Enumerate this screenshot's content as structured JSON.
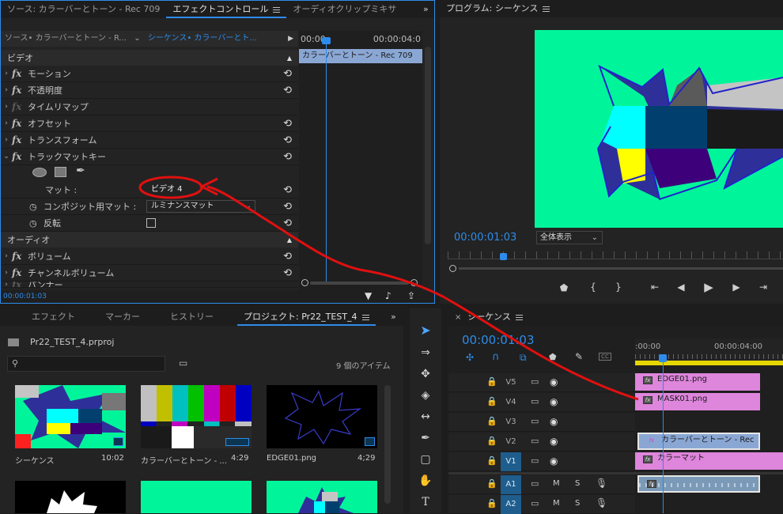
{
  "effect_panel": {
    "tabs": [
      "ソース: カラーバーとトーン - Rec 709",
      "エフェクトコントロール",
      "オーディオクリップミキサ"
    ],
    "source_label": "ソース• カラーバーとトーン - R...",
    "sequence_label": "シーケンス• カラーバーとト...",
    "time_start": "00:00",
    "time_end": "00:00:04:0",
    "clip_name": "カラーバーとトーン - Rec 709",
    "video_section": "ビデオ",
    "audio_section": "オーディオ",
    "effects": [
      "モーション",
      "不透明度",
      "タイムリマップ",
      "オフセット",
      "トランスフォーム",
      "トラックマットキー"
    ],
    "matte_label": "マット :",
    "matte_value": "ビデオ 4",
    "composite_label": "コンポジット用マット :",
    "composite_value": "ルミナンスマット",
    "reverse_label": "反転",
    "audio_effects": [
      "ボリューム",
      "チャンネルボリューム",
      "パンナー"
    ],
    "timecode": "00:00:01:03"
  },
  "program": {
    "title": "プログラム: シーケンス",
    "timecode": "00:00:01:03",
    "fit_label": "全体表示"
  },
  "project_panel": {
    "tabs": [
      "エフェクト",
      "マーカー",
      "ヒストリー",
      "プロジェクト: Pr22_TEST_4"
    ],
    "file_name": "Pr22_TEST_4.prproj",
    "item_count": "9 個のアイテム",
    "items": [
      {
        "name": "シーケンス",
        "duration": "10:02"
      },
      {
        "name": "カラーバーとトーン - ...",
        "duration": "4:29"
      },
      {
        "name": "EDGE01.png",
        "duration": "4;29"
      }
    ]
  },
  "timeline": {
    "tab": "シーケンス",
    "timecode": "00:00:01:03",
    "ruler_start": ":00:00",
    "ruler_end": "00:00:04:00",
    "tracks": [
      {
        "name": "V5",
        "clip": "EDGE01.png"
      },
      {
        "name": "V4",
        "clip": "MASK01.png"
      },
      {
        "name": "V3",
        "clip": ""
      },
      {
        "name": "V2",
        "clip": "カラーバーとトーン - Rec"
      },
      {
        "name": "V1",
        "clip": "カラーマット"
      },
      {
        "name": "A1",
        "clip": ""
      },
      {
        "name": "A2",
        "clip": ""
      }
    ],
    "m_label": "M",
    "s_label": "S"
  },
  "colors": {
    "accent": "#2d8ceb",
    "annotation": "#e01010",
    "clip_pink": "#de85dc",
    "clip_blue": "#8aa7d4",
    "program_bg": "#00f59a"
  }
}
